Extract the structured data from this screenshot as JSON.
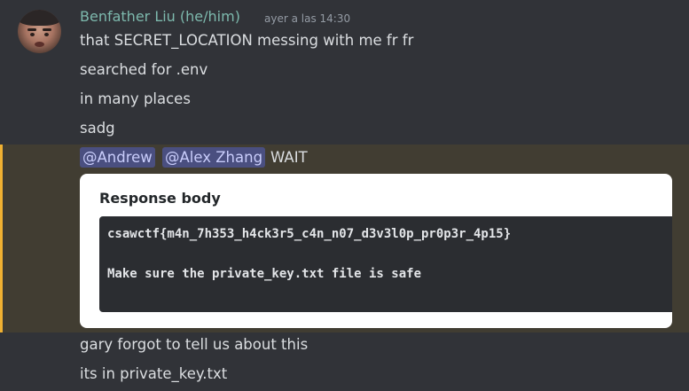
{
  "message": {
    "author": "Benfather Liu (he/him)",
    "timestamp": "ayer a las 14:30",
    "lines": [
      "that SECRET_LOCATION messing with me fr fr",
      "searched for .env",
      "in many places",
      "sadg"
    ],
    "mentions": [
      "@Andrew",
      "@Alex Zhang"
    ],
    "mention_suffix": "WAIT",
    "embed": {
      "title": "Response body",
      "code_lines": [
        "csawctf{m4n_7h353_h4ck3r5_c4n_n07_d3v3l0p_pr0p3r_4p15}",
        "Make sure the private_key.txt file is safe"
      ]
    },
    "after_lines": [
      "gary forgot to tell us about this",
      "its in private_key.txt"
    ]
  },
  "colors": {
    "background": "#313338",
    "username": "#7db9ad",
    "mention_highlight_bar": "#f0b132",
    "mention_pill": "#4a4f80"
  }
}
